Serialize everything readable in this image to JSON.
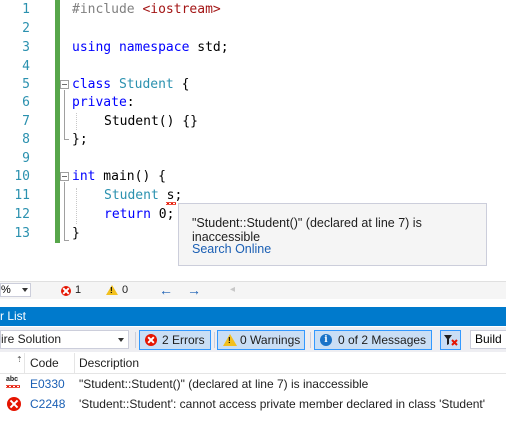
{
  "editor": {
    "line_numbers": [
      "1",
      "2",
      "3",
      "4",
      "5",
      "6",
      "7",
      "8",
      "9",
      "10",
      "11",
      "12",
      "13"
    ],
    "lines": {
      "l1_directive": "#include",
      "l1_header": " <iostream>",
      "l3_using": "using",
      "l3_namespace": " namespace",
      "l3_rest": " std;",
      "l5_class": "class",
      "l5_name": " Student",
      "l5_brace": " {",
      "l6_private": "private",
      "l6_colon": ":",
      "l7_ctor": "Student() {}",
      "l8_close": "};",
      "l10_int": "int",
      "l10_rest": " main() {",
      "l11_type": "Student",
      "l11_var": " s",
      "l11_semi": ";",
      "l12_return": "return",
      "l12_rest": " 0;",
      "l13_close": "}"
    }
  },
  "tooltip": {
    "message": "\"Student::Student()\" (declared at line 7) is inaccessible",
    "link": "Search Online"
  },
  "statusbar": {
    "zoom": "%",
    "error_count": "1",
    "warning_count": "0",
    "back_arrow": "←",
    "forward_arrow": "→"
  },
  "error_list": {
    "title": "r List",
    "scope": "ire Solution",
    "errors_button": "2 Errors",
    "warnings_button": "0 Warnings",
    "messages_button": "0 of 2 Messages",
    "build_select": "Build",
    "columns": {
      "code": "Code",
      "description": "Description"
    },
    "rows": [
      {
        "icon": "intellisense-error-icon",
        "code": "E0330",
        "description": "\"Student::Student()\" (declared at line 7) is inaccessible"
      },
      {
        "icon": "error-icon",
        "code": "C2248",
        "description": "'Student::Student': cannot access private member declared in class 'Student'"
      }
    ]
  },
  "colors": {
    "keyword": "#0000ff",
    "type": "#2b91af",
    "string": "#a31515",
    "accent": "#007acc",
    "error": "#e51400",
    "change_bar": "#57a64a"
  }
}
